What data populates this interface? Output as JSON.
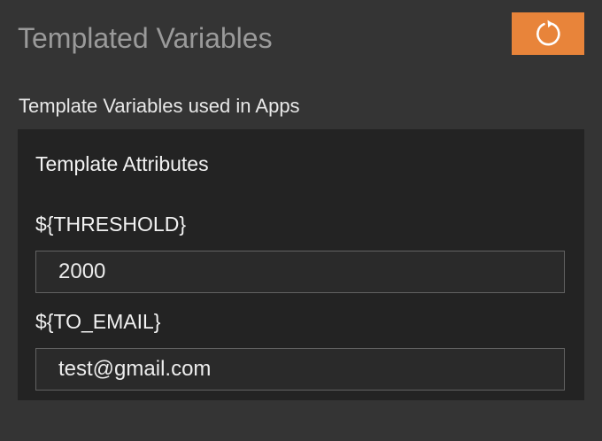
{
  "header": {
    "title": "Templated Variables",
    "refresh_icon": "refresh-icon",
    "accent_color": "#e8843a"
  },
  "section": {
    "subtitle": "Template Variables used in Apps"
  },
  "attributes": {
    "heading": "Template Attributes",
    "variables": [
      {
        "label": "${THRESHOLD}",
        "value": "2000"
      },
      {
        "label": "${TO_EMAIL}",
        "value": "test@gmail.com"
      }
    ]
  }
}
